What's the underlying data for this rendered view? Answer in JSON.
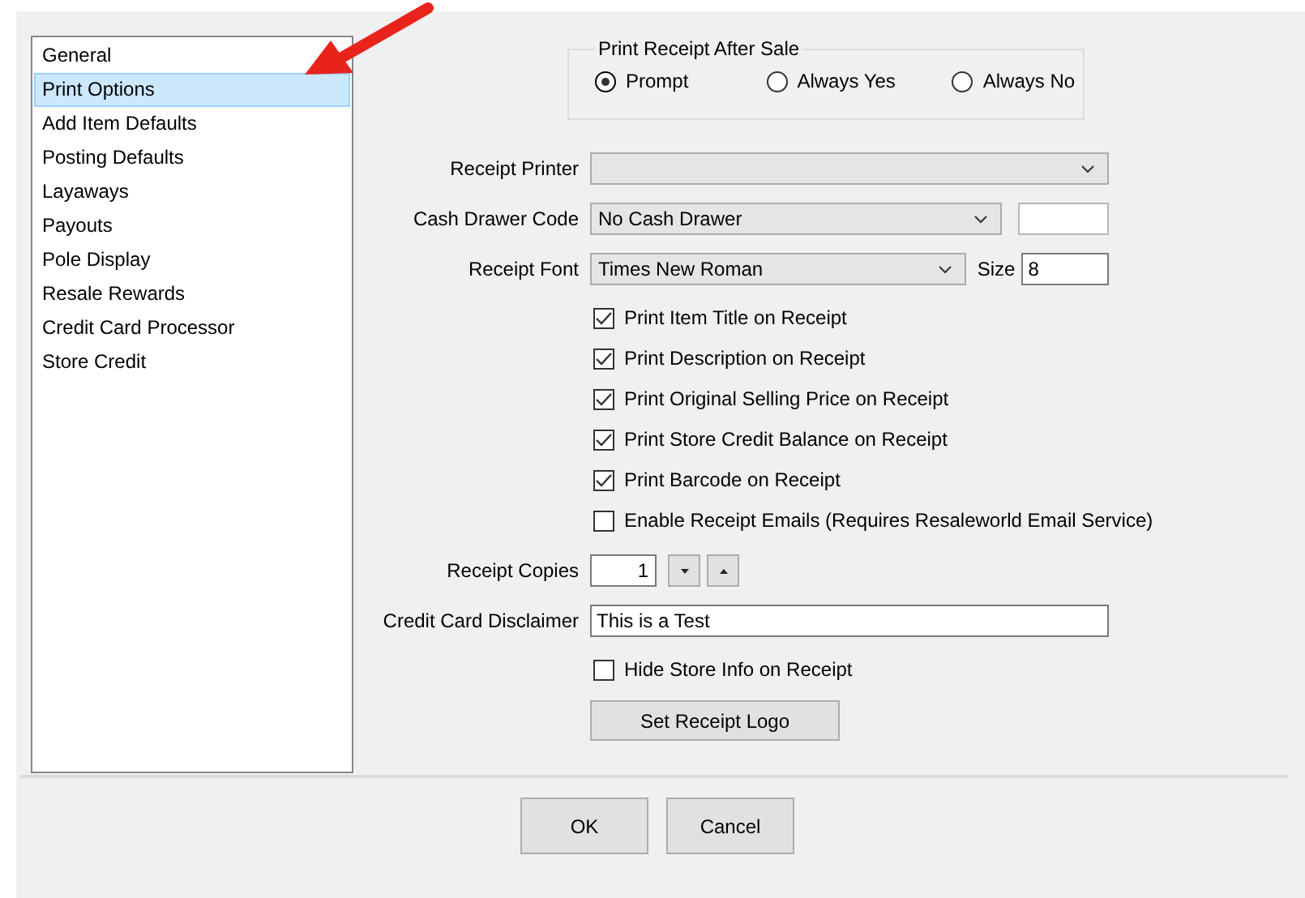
{
  "sidebar": {
    "items": [
      {
        "label": "General",
        "selected": false
      },
      {
        "label": "Print Options",
        "selected": true
      },
      {
        "label": "Add Item Defaults",
        "selected": false
      },
      {
        "label": "Posting Defaults",
        "selected": false
      },
      {
        "label": "Layaways",
        "selected": false
      },
      {
        "label": "Payouts",
        "selected": false
      },
      {
        "label": "Pole Display",
        "selected": false
      },
      {
        "label": "Resale Rewards",
        "selected": false
      },
      {
        "label": "Credit Card Processor",
        "selected": false
      },
      {
        "label": "Store Credit",
        "selected": false
      }
    ]
  },
  "print_receipt_after_sale": {
    "title": "Print Receipt After Sale",
    "options": [
      {
        "label": "Prompt",
        "selected": true
      },
      {
        "label": "Always Yes",
        "selected": false
      },
      {
        "label": "Always No",
        "selected": false
      }
    ]
  },
  "form": {
    "rows": [
      {
        "kind": "combo",
        "label": "Receipt Printer"
      },
      {
        "kind": "combo-extra",
        "label": "Cash Drawer Code",
        "value": "No Cash Drawer"
      },
      {
        "kind": "font",
        "label": "Receipt Font",
        "value": "Times New Roman",
        "size_label": "Size",
        "size": "8"
      },
      {
        "kind": "checkbox",
        "label": "Print Item Title on Receipt",
        "checked": true
      },
      {
        "kind": "checkbox",
        "label": "Print Description on Receipt",
        "checked": true
      },
      {
        "kind": "checkbox",
        "label": "Print Original Selling Price on Receipt",
        "checked": true
      },
      {
        "kind": "checkbox",
        "label": "Print Store Credit Balance on Receipt",
        "checked": true
      },
      {
        "kind": "checkbox",
        "label": "Print Barcode on Receipt",
        "checked": true
      },
      {
        "kind": "checkbox",
        "label": "Enable Receipt Emails (Requires Resaleworld Email Service)",
        "checked": false
      },
      {
        "kind": "spin",
        "label": "Receipt Copies",
        "value": "1"
      },
      {
        "kind": "text",
        "label": "Credit Card Disclaimer",
        "value": "This is a Test"
      },
      {
        "kind": "checkbox",
        "label": "Hide Store Info on Receipt",
        "checked": false
      },
      {
        "kind": "button",
        "label": "Set Receipt Logo"
      }
    ]
  },
  "buttons": [
    "OK",
    "Cancel"
  ]
}
